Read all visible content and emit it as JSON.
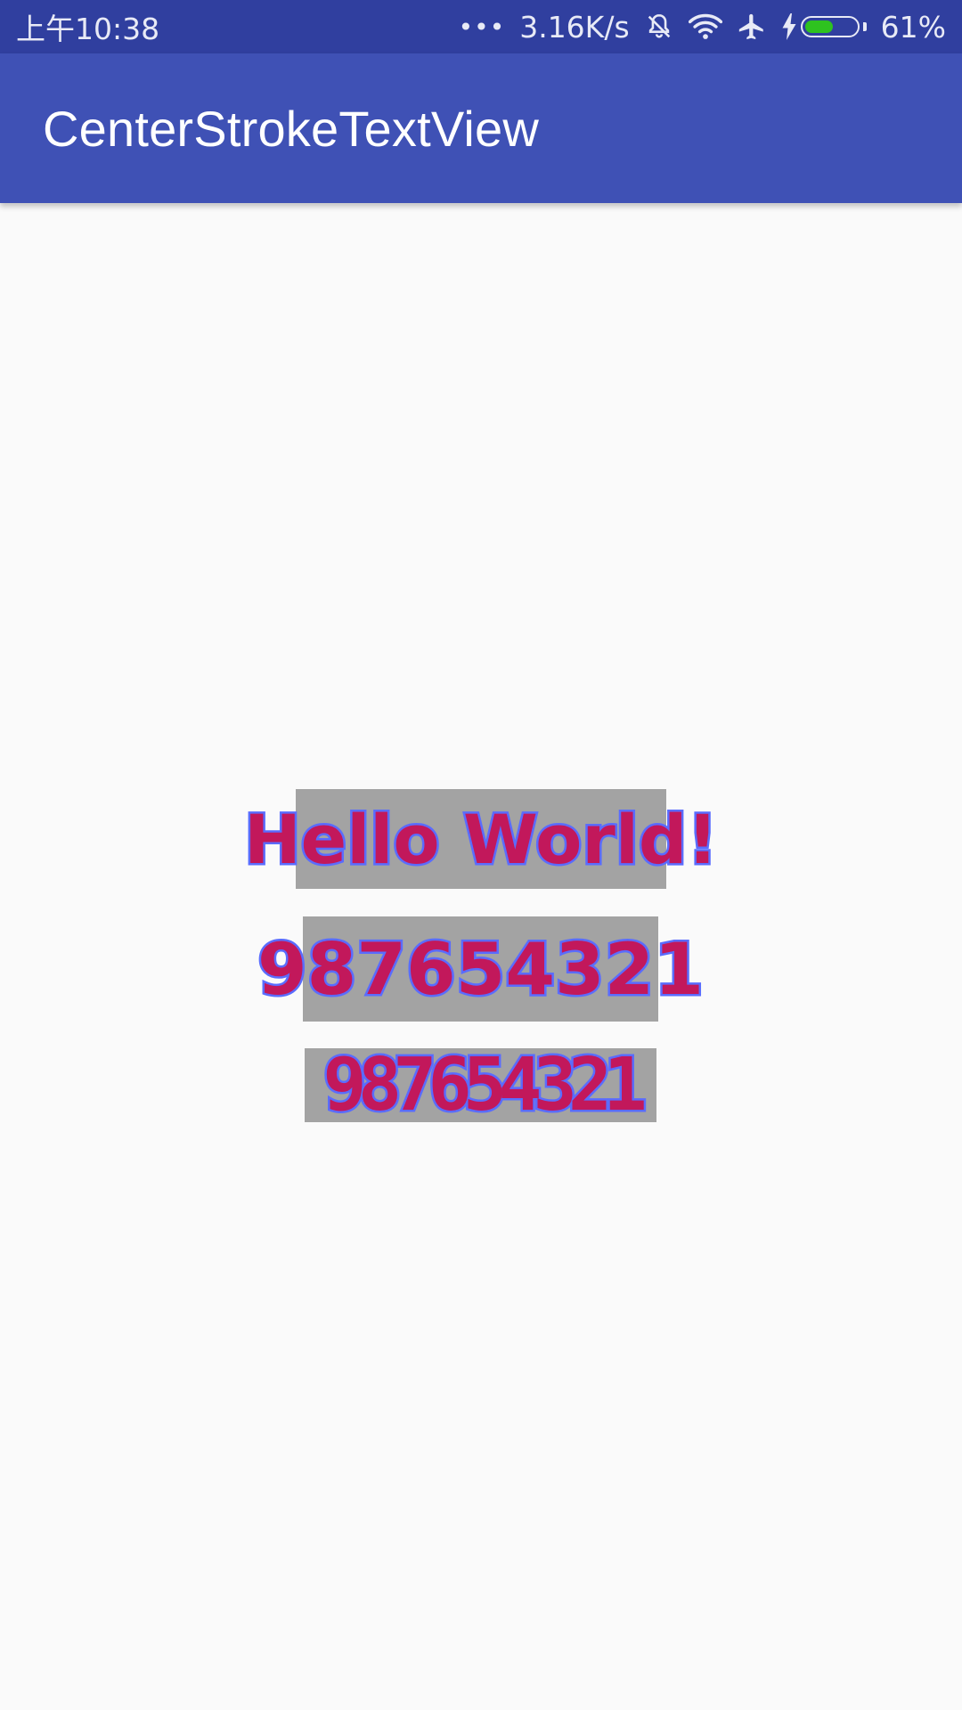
{
  "status_bar": {
    "time": "上午10:38",
    "more": "•••",
    "network_speed": "3.16K/s",
    "battery_percent": "61%",
    "battery_level": 0.61,
    "battery_color": "#2ec21f",
    "icons": [
      "mute-vibrate-icon",
      "wifi-icon",
      "airplane-icon",
      "charging-bolt-icon",
      "battery-icon"
    ]
  },
  "app_bar": {
    "title": "CenterStrokeTextView",
    "color": "#3f51b5"
  },
  "content": {
    "items": [
      {
        "text": "Hello World!"
      },
      {
        "text": "987654321"
      },
      {
        "text": "987654321"
      }
    ],
    "text_color": "#c2185b",
    "stroke_color": "#5a6cff",
    "box_color": "#a3a3a3"
  }
}
